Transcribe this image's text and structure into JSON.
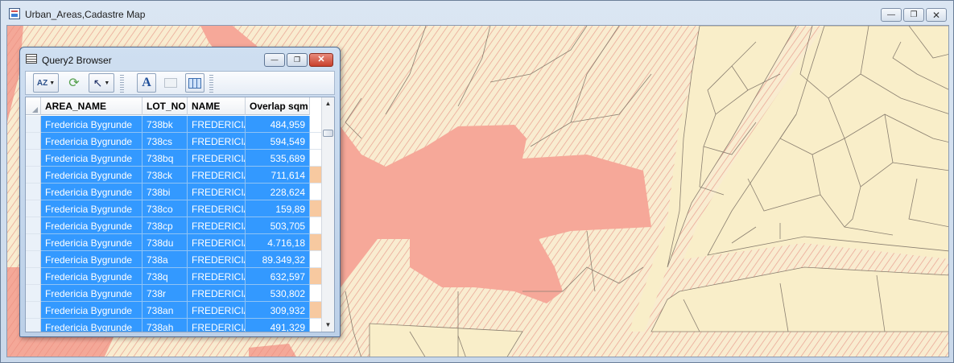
{
  "map_window": {
    "title": "Urban_Areas,Cadastre Map",
    "minimize_symbol": "—",
    "restore_symbol": "❐",
    "close_symbol": "✕"
  },
  "query_browser": {
    "title": "Query2 Browser",
    "minimize_symbol": "—",
    "restore_symbol": "❐",
    "close_symbol": "✕",
    "toolbar": {
      "sort_icon": "sort-az-icon",
      "refresh_icon": "refresh-icon",
      "select_icon": "pointer-select-icon",
      "font_icon": "font-style-icon",
      "new_record_icon": "add-row-icon",
      "columns_icon": "columns-icon",
      "sort_label": "AZ",
      "select_label": "↖",
      "font_label": "A",
      "refresh_label": "⟳"
    },
    "columns": [
      "AREA_NAME",
      "LOT_NO",
      "NAME",
      "Overlap sqm"
    ],
    "rows": [
      [
        "Fredericia Bygrunde",
        "738bk",
        "FREDERICIA",
        "484,959"
      ],
      [
        "Fredericia Bygrunde",
        "738cs",
        "FREDERICIA",
        "594,549"
      ],
      [
        "Fredericia Bygrunde",
        "738bq",
        "FREDERICIA",
        "535,689"
      ],
      [
        "Fredericia Bygrunde",
        "738ck",
        "FREDERICIA",
        "711,614"
      ],
      [
        "Fredericia Bygrunde",
        "738bi",
        "FREDERICIA",
        "228,624"
      ],
      [
        "Fredericia Bygrunde",
        "738co",
        "FREDERICIA",
        "159,89"
      ],
      [
        "Fredericia Bygrunde",
        "738cp",
        "FREDERICIA",
        "503,705"
      ],
      [
        "Fredericia Bygrunde",
        "738du",
        "FREDERICIA",
        "4.716,18"
      ],
      [
        "Fredericia Bygrunde",
        "738a",
        "FREDERICIA",
        "89.349,32"
      ],
      [
        "Fredericia Bygrunde",
        "738q",
        "FREDERICIA",
        "632,597"
      ],
      [
        "Fredericia Bygrunde",
        "738r",
        "FREDERICIA",
        "530,802"
      ],
      [
        "Fredericia Bygrunde",
        "738an",
        "FREDERICIA",
        "309,932"
      ],
      [
        "Fredericia Bygrunde",
        "738ah",
        "FREDERICIA",
        "491,329"
      ]
    ],
    "scroll_up": "▲",
    "scroll_down": "▼"
  },
  "colors": {
    "selection_blue": "#3399ff",
    "parcel_fill": "#f9eec9",
    "urban_area_fill": "#f6a899",
    "parcel_line": "#8a7f70"
  }
}
